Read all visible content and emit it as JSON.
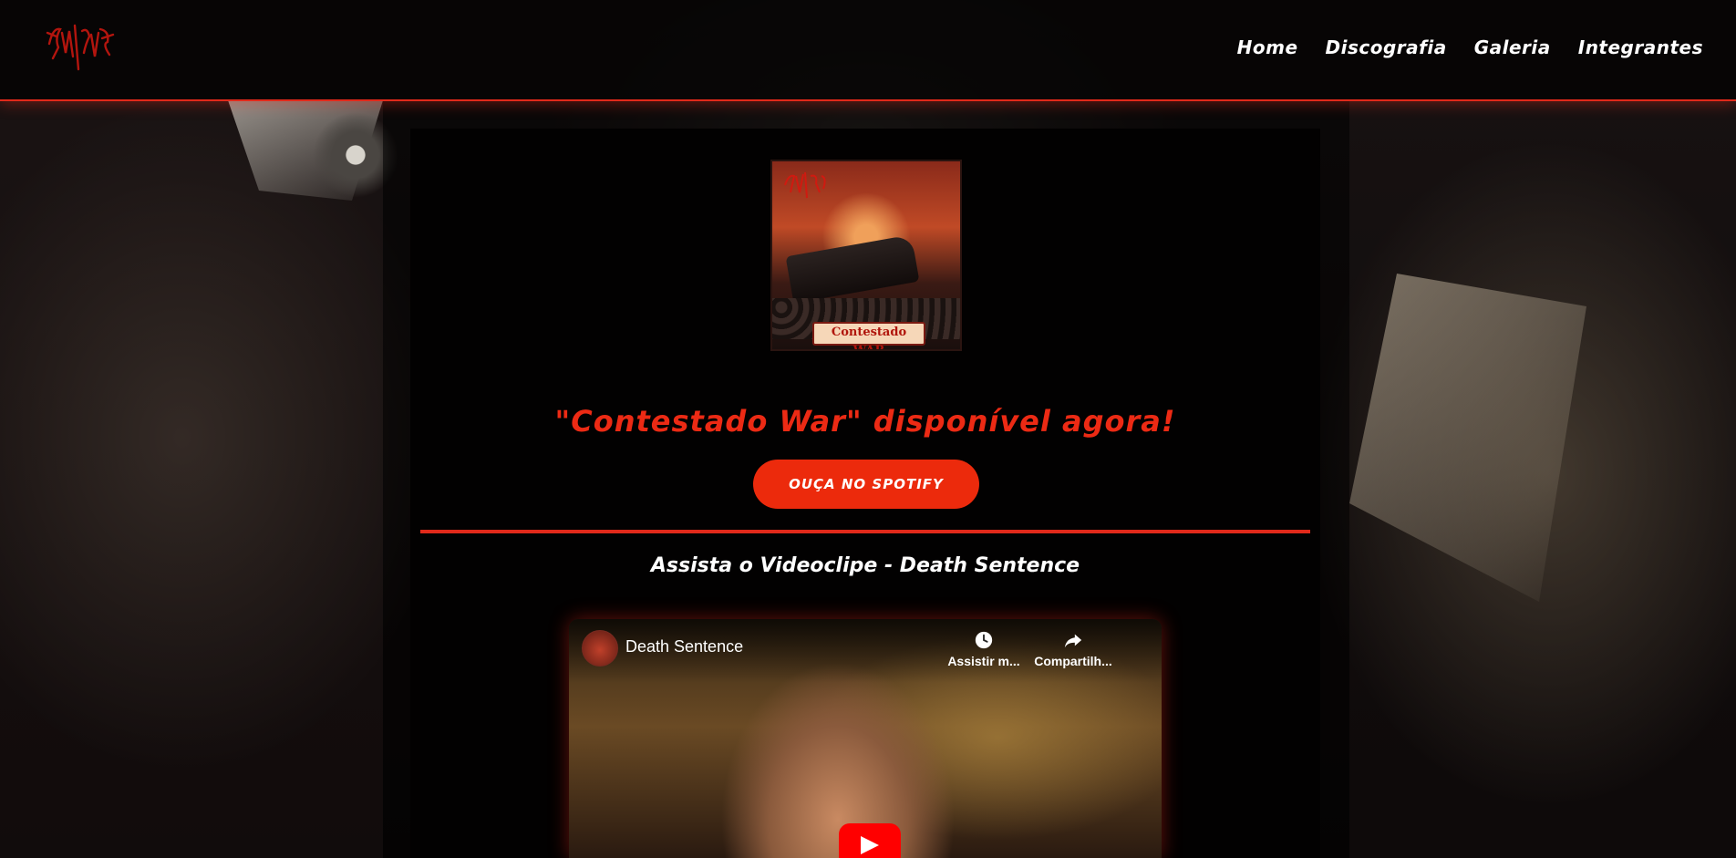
{
  "header": {
    "logo_text": "SATURNE",
    "nav": [
      {
        "label": "Home"
      },
      {
        "label": "Discografia"
      },
      {
        "label": "Galeria"
      },
      {
        "label": "Integrantes"
      }
    ]
  },
  "album": {
    "cover_title": "Contestado WAR"
  },
  "hero": {
    "headline": "\"Contestado War\" disponível agora!",
    "cta_label": "OUÇA NO SPOTIFY"
  },
  "video_section": {
    "heading": "Assista o Videoclipe - Death Sentence",
    "video_title": "Death Sentence",
    "watch_later_label": "Assistir m...",
    "share_label": "Compartilh..."
  },
  "colors": {
    "accent": "#e1291a",
    "button": "#ec2a0c",
    "headline": "#ec2a14",
    "youtube_red": "#ff0000"
  },
  "icons": [
    "logo",
    "clock-icon",
    "share-icon",
    "play-icon"
  ]
}
